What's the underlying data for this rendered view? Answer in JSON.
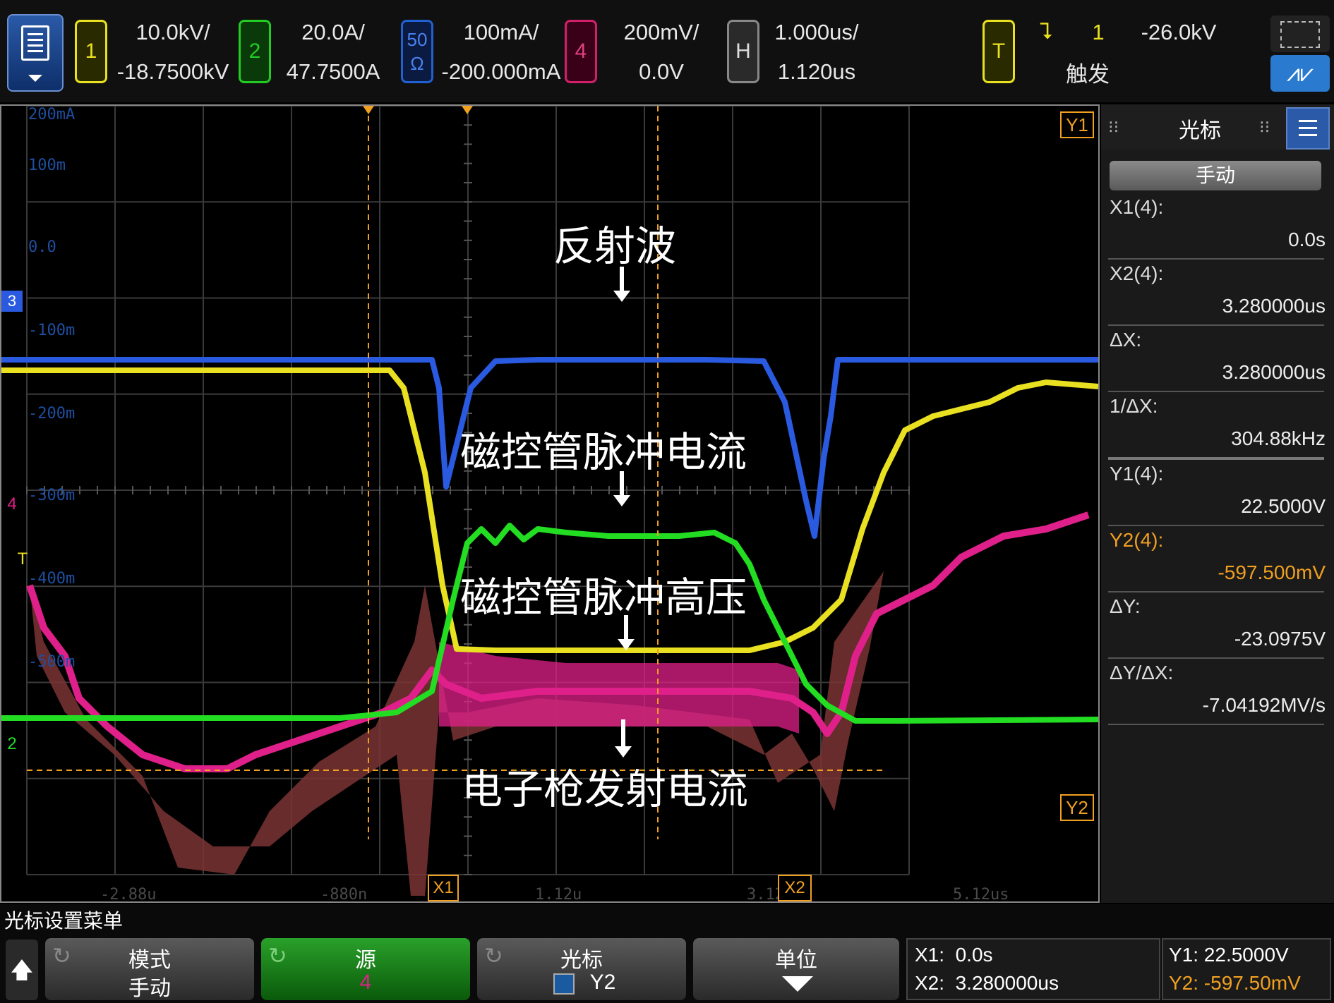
{
  "topbar": {
    "ch1": {
      "num": "1",
      "scale": "10.0kV/",
      "offset": "-18.7500kV",
      "color": "#e8e020"
    },
    "ch2": {
      "num": "2",
      "scale": "20.0A/",
      "offset": "47.7500A",
      "color": "#22cc22"
    },
    "ch3": {
      "num_top": "50",
      "num_bot": "Ω",
      "scale": "100mA/",
      "offset": "-200.000mA",
      "color": "#2060d0"
    },
    "ch4": {
      "num": "4",
      "scale": "200mV/",
      "offset": "0.0V",
      "color": "#d0206a"
    },
    "horiz": {
      "label": "H",
      "scale": "1.000us/",
      "delay": "1.120us"
    },
    "trigger": {
      "label": "T",
      "source": "1",
      "level": "-26.0kV",
      "mode": "触发"
    }
  },
  "screen": {
    "y_labels": [
      "200mA",
      "100m",
      "0.0",
      "-100m",
      "-200m",
      "-300m",
      "-400m",
      "-500m"
    ],
    "x_labels": [
      "-2.88u",
      "-880n",
      "1.12u",
      "3.12u",
      "5.12us"
    ],
    "markers": {
      "x1": "X1",
      "x2": "X2",
      "y1": "Y1",
      "y2": "Y2",
      "ch3": "3",
      "ch4": "4",
      "ch2": "2",
      "trig": "T"
    },
    "annotations": {
      "reflected": "反射波",
      "mag_current": "磁控管脉冲电流",
      "mag_voltage": "磁控管脉冲高压",
      "gun_current": "电子枪发射电流"
    }
  },
  "cursor_panel": {
    "title": "光标",
    "mode": "手动",
    "x1_label": "X1(4):",
    "x1_value": "0.0s",
    "x2_label": "X2(4):",
    "x2_value": "3.280000us",
    "dx_label": "ΔX:",
    "dx_value": "3.280000us",
    "inv_dx_label": "1/ΔX:",
    "inv_dx_value": "304.88kHz",
    "y1_label": "Y1(4):",
    "y1_value": "22.5000V",
    "y2_label": "Y2(4):",
    "y2_value": "-597.500mV",
    "dy_label": "ΔY:",
    "dy_value": "-23.0975V",
    "dydx_label": "ΔY/ΔX:",
    "dydx_value": "-7.04192MV/s"
  },
  "bottom": {
    "caption": "光标设置菜单",
    "mode_label": "模式",
    "mode_value": "手动",
    "source_label": "源",
    "source_value": "4",
    "cursor_label": "光标",
    "cursor_value": "Y2",
    "units_label": "单位",
    "readout_x1": "X1:  0.0s",
    "readout_x2": "X2:  3.280000us",
    "readout_y1": "Y1: 22.5000V",
    "readout_y2": "Y2: -597.50mV"
  },
  "colors": {
    "ch1": "#e8e020",
    "ch2": "#22dd22",
    "ch3": "#2a5ae0",
    "ch4": "#e0208a",
    "cursor": "#f0a020"
  }
}
